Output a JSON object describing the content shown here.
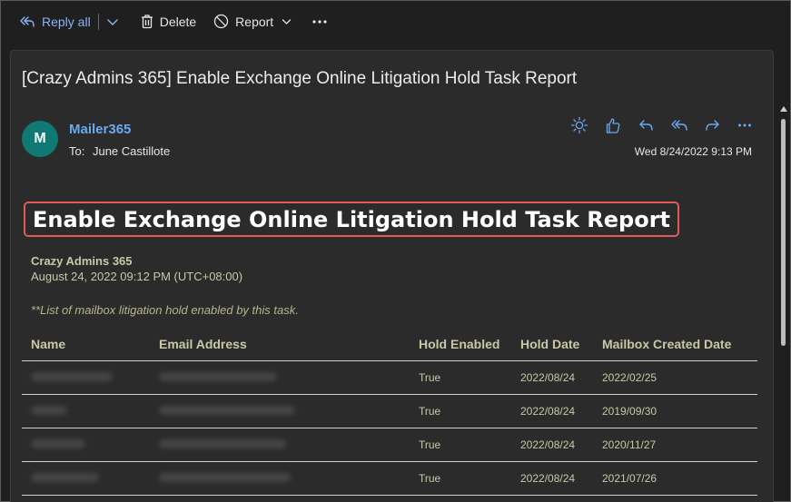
{
  "toolbar": {
    "reply_all_label": "Reply all",
    "delete_label": "Delete",
    "report_label": "Report",
    "more_icon": "more-horizontal-icon"
  },
  "email": {
    "subject": "[Crazy Admins 365] Enable Exchange Online Litigation Hold Task Report",
    "avatar_initial": "M",
    "sender": "Mailer365",
    "to_label": "To:",
    "to_name": "June Castillote",
    "date": "Wed 8/24/2022 9:13 PM"
  },
  "report": {
    "title": "Enable Exchange Online Litigation Hold Task Report",
    "org": "Crazy Admins 365",
    "datetime": "August 24, 2022 09:12 PM (UTC+08:00)",
    "note": "**List of mailbox litigation hold enabled by this task.",
    "columns": [
      "Name",
      "Email Address",
      "Hold Enabled",
      "Hold Date",
      "Mailbox Created Date"
    ],
    "rows": [
      {
        "hold_enabled": "True",
        "hold_date": "2022/08/24",
        "created": "2022/02/25"
      },
      {
        "hold_enabled": "True",
        "hold_date": "2022/08/24",
        "created": "2019/09/30"
      },
      {
        "hold_enabled": "True",
        "hold_date": "2022/08/24",
        "created": "2020/11/27"
      },
      {
        "hold_enabled": "True",
        "hold_date": "2022/08/24",
        "created": "2021/07/26"
      }
    ]
  },
  "colors": {
    "accent": "#8ab4f8",
    "sender": "#6aa9f0",
    "avatar_bg": "#0e7a73",
    "highlight_border": "#e05a5a",
    "report_text": "#c9c8a6"
  }
}
